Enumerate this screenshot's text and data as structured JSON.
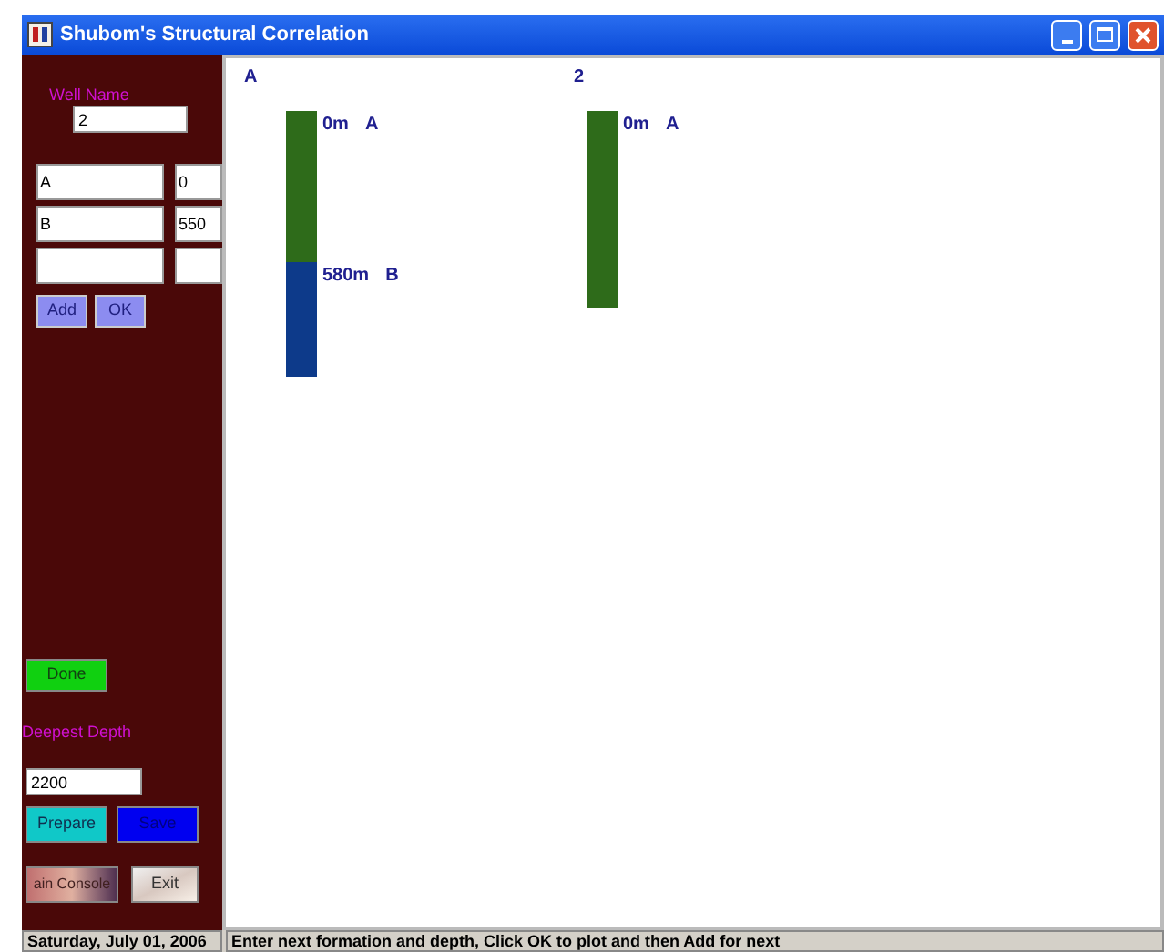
{
  "window": {
    "title": "Shubom's Structural Correlation"
  },
  "form": {
    "well_name_label": "Well Name",
    "well_name": "2",
    "rows": [
      {
        "formation": "A",
        "depth": "0"
      },
      {
        "formation": "B",
        "depth": "550"
      }
    ],
    "buttons": [
      "Add",
      "OK"
    ],
    "done": "Done",
    "deepest_depth_label": "Deepest Depth",
    "deepest_depth": "2200",
    "prepare": "Prepare",
    "save": "Save",
    "main_console": "ain Console",
    "exit": "Exit"
  },
  "wells": [
    {
      "name": "A",
      "segments": [
        {
          "depth": "0m",
          "formation": "A",
          "color": "#2e6b1a"
        },
        {
          "depth": "580m",
          "formation": "B",
          "color": "#0d3a8a"
        }
      ]
    },
    {
      "name": "2",
      "segments": [
        {
          "depth": "0m",
          "formation": "A",
          "color": "#2e6b1a"
        }
      ]
    }
  ],
  "status_bar": {
    "date": "Saturday, July 01, 2006",
    "message": "Enter next formation and depth, Click OK to plot and then Add for next"
  }
}
